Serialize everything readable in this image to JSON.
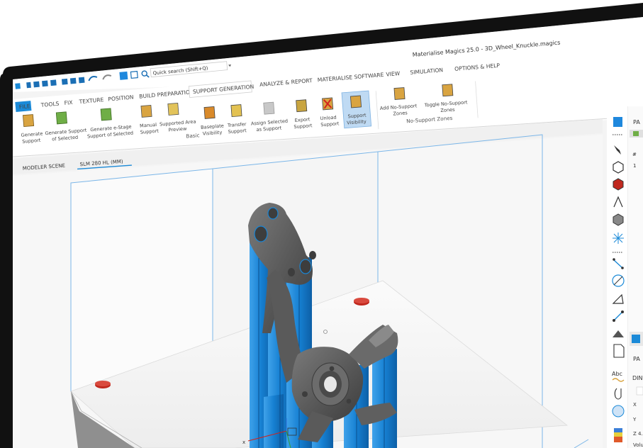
{
  "window": {
    "title": "Materialise Magics 25.0 - 3D_Wheel_Knuckle.magics"
  },
  "quick_access": {
    "search_placeholder": "Quick search (Shift+Q)"
  },
  "tabs": [
    {
      "label": "FILE"
    },
    {
      "label": "TOOLS"
    },
    {
      "label": "FIX"
    },
    {
      "label": "TEXTURE"
    },
    {
      "label": "POSITION"
    },
    {
      "label": "BUILD PREPARATION"
    },
    {
      "label": "SUPPORT GENERATION"
    },
    {
      "label": "ANALYZE & REPORT"
    },
    {
      "label": "MATERIALISE SOFTWARE"
    },
    {
      "label": "VIEW"
    },
    {
      "label": "SIMULATION"
    },
    {
      "label": "OPTIONS & HELP"
    }
  ],
  "ribbon": {
    "basic_group": "Basic",
    "nosupport_group": "No-Support Zones",
    "buttons": {
      "generate_support": [
        "Generate",
        "Support"
      ],
      "generate_selected": [
        "Generate Support",
        "of Selected"
      ],
      "generate_estage": [
        "Generate e-Stage",
        "Support of Selected"
      ],
      "manual_support": [
        "Manual",
        "Support"
      ],
      "supported_area": [
        "Supported Area",
        "Preview"
      ],
      "baseplate_visibility": [
        "Baseplate",
        "Visibility"
      ],
      "transfer_support": [
        "Transfer",
        "Support"
      ],
      "assign_selected": [
        "Assign Selected",
        "as Support"
      ],
      "export_support": [
        "Export",
        "Support"
      ],
      "unload_support": [
        "Unload",
        "Support"
      ],
      "support_visibility": [
        "Support",
        "Visibility"
      ],
      "add_nosupport": [
        "Add No-Support",
        "Zones"
      ],
      "toggle_nosupport": [
        "Toggle No-Support",
        "Zones"
      ]
    }
  },
  "scene_tabs": [
    {
      "label": "MODELER SCENE"
    },
    {
      "label": "SLM 280 HL (MM)"
    }
  ],
  "right_panel": {
    "header_partial": "PA",
    "hash": "#",
    "row_number": "1",
    "header2_partial": "PA",
    "dim_partial": "DIN",
    "x_label": "X",
    "y_label": "Y",
    "z_label": "Z",
    "z_value_partial": "4.",
    "volume_partial": "Volu",
    "abc_label": "Abc"
  },
  "axis": {
    "x_label": "x"
  },
  "colors": {
    "accent_blue": "#1b8ad8",
    "support_blue": "#1a86d6",
    "part_gray": "#5d5d5d",
    "marker_red": "#c0281e",
    "bezel": "#111111"
  }
}
